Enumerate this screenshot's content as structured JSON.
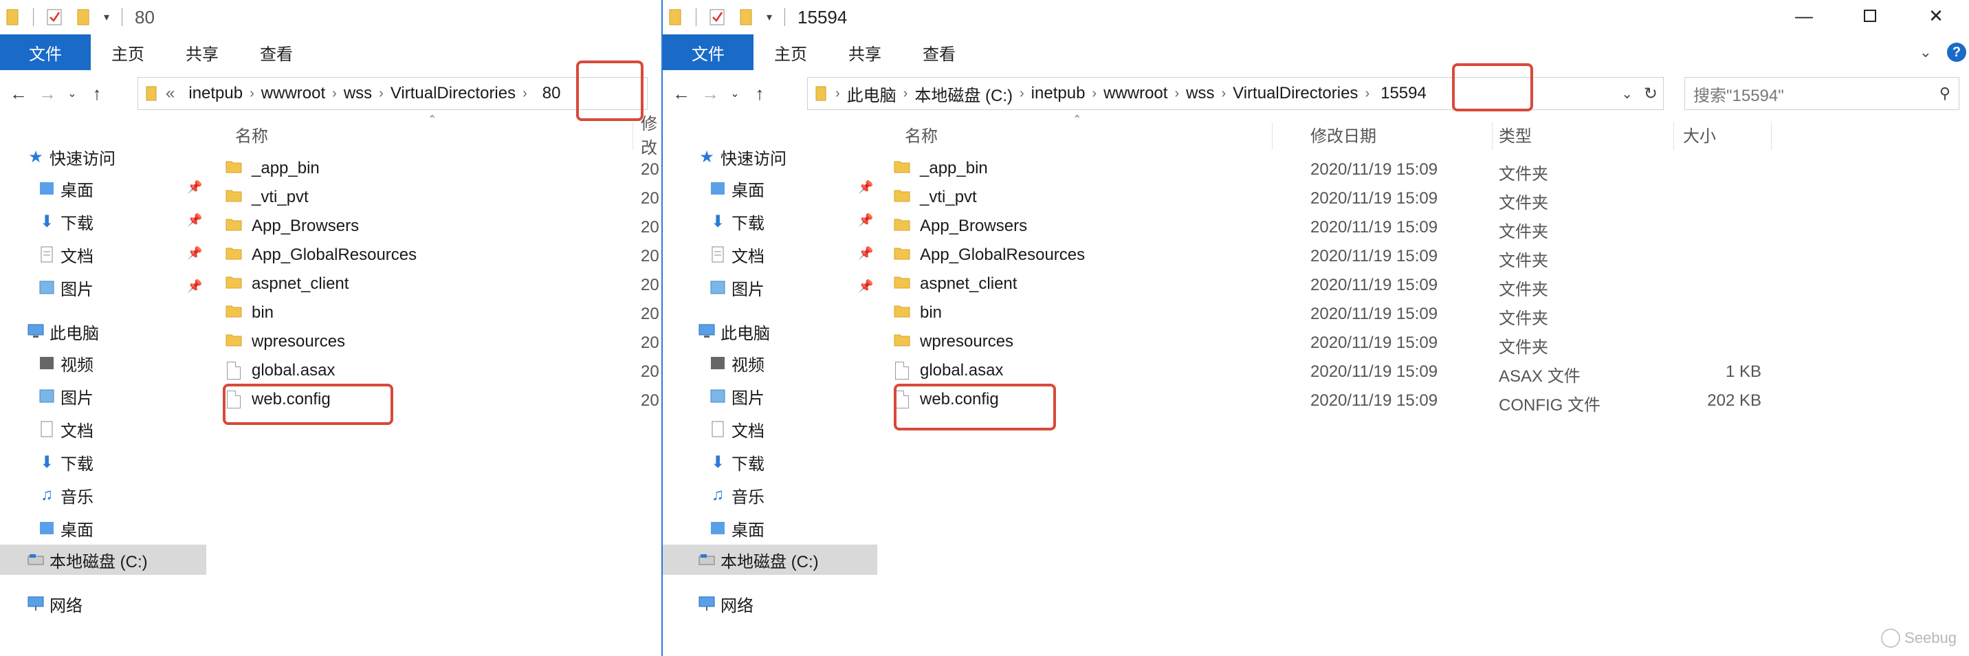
{
  "left_window": {
    "title": "80",
    "ribbon_tabs": [
      "文件",
      "主页",
      "共享",
      "查看"
    ],
    "breadcrumb": [
      "«",
      "inetpub",
      "wwwroot",
      "wss",
      "VirtualDirectories",
      "80"
    ],
    "columns": {
      "name": "名称",
      "date_partial": "修改"
    },
    "nav": {
      "quick_access": "快速访问",
      "quick_items": [
        "桌面",
        "下载",
        "文档",
        "图片"
      ],
      "this_pc": "此电脑",
      "pc_items": [
        "视频",
        "图片",
        "文档",
        "下载",
        "音乐",
        "桌面",
        "本地磁盘 (C:)"
      ],
      "network": "网络"
    },
    "files": [
      {
        "name": "_app_bin",
        "type": "folder",
        "date": "20"
      },
      {
        "name": "_vti_pvt",
        "type": "folder",
        "date": "20"
      },
      {
        "name": "App_Browsers",
        "type": "folder",
        "date": "20"
      },
      {
        "name": "App_GlobalResources",
        "type": "folder",
        "date": "20"
      },
      {
        "name": "aspnet_client",
        "type": "folder",
        "date": "20"
      },
      {
        "name": "bin",
        "type": "folder",
        "date": "20"
      },
      {
        "name": "wpresources",
        "type": "folder",
        "date": "20"
      },
      {
        "name": "global.asax",
        "type": "file",
        "date": "20"
      },
      {
        "name": "web.config",
        "type": "file",
        "date": "20"
      }
    ]
  },
  "right_window": {
    "title": "15594",
    "ribbon_tabs": [
      "文件",
      "主页",
      "共享",
      "查看"
    ],
    "breadcrumb": [
      "此电脑",
      "本地磁盘 (C:)",
      "inetpub",
      "wwwroot",
      "wss",
      "VirtualDirectories",
      "15594"
    ],
    "search_placeholder": "搜索\"15594\"",
    "columns": {
      "name": "名称",
      "date": "修改日期",
      "type": "类型",
      "size": "大小"
    },
    "nav": {
      "quick_access": "快速访问",
      "quick_items": [
        "桌面",
        "下载",
        "文档",
        "图片"
      ],
      "this_pc": "此电脑",
      "pc_items": [
        "视频",
        "图片",
        "文档",
        "下载",
        "音乐",
        "桌面",
        "本地磁盘 (C:)"
      ],
      "network": "网络"
    },
    "files": [
      {
        "name": "_app_bin",
        "type": "folder",
        "date": "2020/11/19 15:09",
        "kind": "文件夹",
        "size": ""
      },
      {
        "name": "_vti_pvt",
        "type": "folder",
        "date": "2020/11/19 15:09",
        "kind": "文件夹",
        "size": ""
      },
      {
        "name": "App_Browsers",
        "type": "folder",
        "date": "2020/11/19 15:09",
        "kind": "文件夹",
        "size": ""
      },
      {
        "name": "App_GlobalResources",
        "type": "folder",
        "date": "2020/11/19 15:09",
        "kind": "文件夹",
        "size": ""
      },
      {
        "name": "aspnet_client",
        "type": "folder",
        "date": "2020/11/19 15:09",
        "kind": "文件夹",
        "size": ""
      },
      {
        "name": "bin",
        "type": "folder",
        "date": "2020/11/19 15:09",
        "kind": "文件夹",
        "size": ""
      },
      {
        "name": "wpresources",
        "type": "folder",
        "date": "2020/11/19 15:09",
        "kind": "文件夹",
        "size": ""
      },
      {
        "name": "global.asax",
        "type": "file",
        "date": "2020/11/19 15:09",
        "kind": "ASAX 文件",
        "size": "1 KB"
      },
      {
        "name": "web.config",
        "type": "file",
        "date": "2020/11/19 15:09",
        "kind": "CONFIG 文件",
        "size": "202 KB"
      }
    ]
  },
  "watermark": "Seebug",
  "colors": {
    "accent": "#1a6bc8",
    "highlight": "#d84a3a",
    "folder": "#f3c44c",
    "selected": "#d9d9d9"
  }
}
